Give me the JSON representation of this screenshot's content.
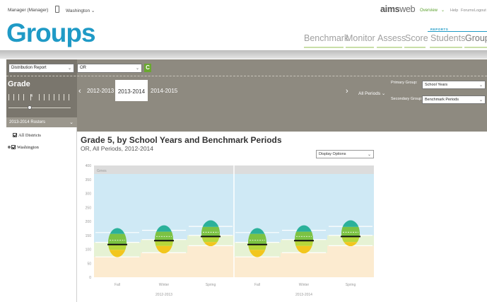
{
  "header": {
    "user": "Manager (Manager)",
    "location": "Washington",
    "logo_prefix": "aims",
    "logo_suffix": "web",
    "links": {
      "overview": "Overview",
      "help": "Help",
      "forums": "Forums",
      "logout": "Logout"
    }
  },
  "page_title": "Groups",
  "nav": {
    "section_label": "REPORTS",
    "tabs": [
      {
        "label": "Benchmark"
      },
      {
        "label": "Monitor"
      },
      {
        "label": "Assess"
      },
      {
        "label": "Score"
      },
      {
        "label": "Students"
      },
      {
        "label": "Groups"
      }
    ]
  },
  "filters": {
    "report_type": "Distribution Report",
    "district": "OR",
    "grade_label": "Grade",
    "grade_value": "4",
    "years": [
      "2012-2013",
      "2013-2014",
      "2014-2015"
    ],
    "active_year": "2013-2014",
    "periods": "All Periods",
    "primary_group_label": "Primary Group:",
    "primary_group": "School Years",
    "secondary_group_label": "Secondary Group:",
    "secondary_group": "Benchmark Periods"
  },
  "left_panel": {
    "roster": "2013-2014 Rosters",
    "items": [
      {
        "label": "All Districts"
      },
      {
        "label": "Washington"
      }
    ]
  },
  "chart": {
    "title": "Grade 5, by School Years and Benchmark Periods",
    "subtitle": "OR, All Periods, 2012-2014",
    "display_options": "Display Options",
    "band_label": "Grnes"
  },
  "chart_data": {
    "type": "box",
    "ylim": [
      0,
      400
    ],
    "y_ticks": [
      0,
      50,
      100,
      150,
      200,
      250,
      300,
      350,
      400
    ],
    "groups": [
      "2012-2013",
      "2013-2014"
    ],
    "categories": [
      "Fall",
      "Winter",
      "Spring"
    ],
    "colors": {
      "top": "#2bb19a",
      "upper": "#7cc243",
      "lower": "#b7d73a",
      "bottom": "#f2c61e",
      "bg_blue": "#cfe9f5",
      "bg_green": "#e6f2d4",
      "bg_orange": "#fcebd0"
    },
    "boxes": [
      {
        "group": "2012-2013",
        "period": "Fall",
        "top": 176,
        "q3": 155,
        "median": 117,
        "q1": 98,
        "bottom": 72
      },
      {
        "group": "2012-2013",
        "period": "Winter",
        "top": 186,
        "q3": 163,
        "median": 131,
        "q1": 112,
        "bottom": 85
      },
      {
        "group": "2012-2013",
        "period": "Spring",
        "top": 204,
        "q3": 180,
        "median": 146,
        "q1": 126,
        "bottom": 111
      },
      {
        "group": "2013-2014",
        "period": "Fall",
        "top": 176,
        "q3": 155,
        "median": 117,
        "q1": 98,
        "bottom": 72
      },
      {
        "group": "2013-2014",
        "period": "Winter",
        "top": 186,
        "q3": 163,
        "median": 131,
        "q1": 112,
        "bottom": 85
      },
      {
        "group": "2013-2014",
        "period": "Spring",
        "top": 204,
        "q3": 180,
        "median": 146,
        "q1": 126,
        "bottom": 111
      }
    ],
    "bands": [
      {
        "period": "Fall",
        "blue": 160,
        "green": 125,
        "orange": 73
      },
      {
        "period": "Winter",
        "blue": 168,
        "green": 135,
        "orange": 88
      },
      {
        "period": "Spring",
        "blue": 182,
        "green": 150,
        "orange": 113
      }
    ]
  }
}
